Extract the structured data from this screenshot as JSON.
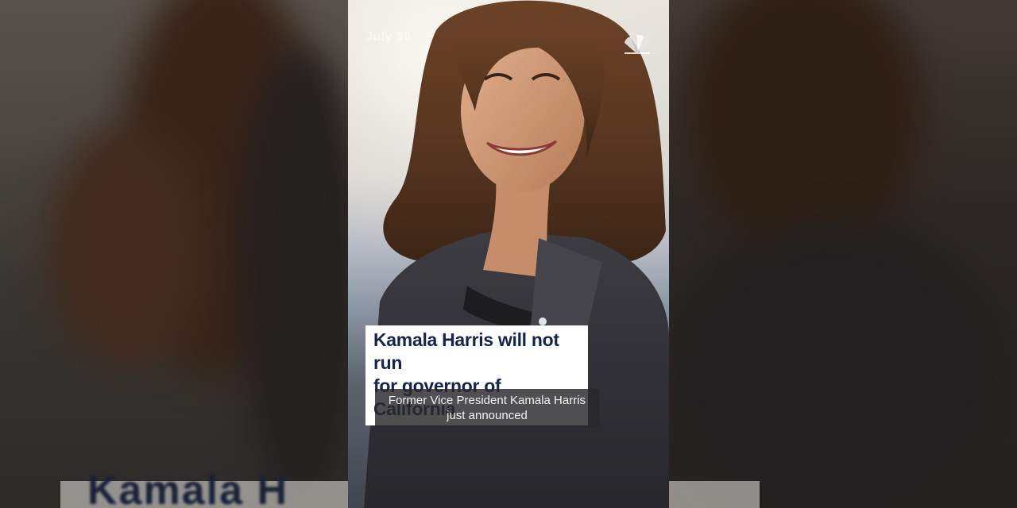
{
  "video": {
    "date_label": "July 30",
    "logo_icon": "nbc-peacock-icon",
    "headline": "Kamala Harris will not run\nfor governor of California",
    "caption": "Former Vice President Kamala Harris\njust announced"
  },
  "background": {
    "blurred_text": "Kamala H"
  },
  "colors": {
    "headline_text": "#17244a",
    "headline_bg": "#ffffff",
    "caption_bg": "#28282c",
    "caption_text": "#f2f2f2"
  }
}
